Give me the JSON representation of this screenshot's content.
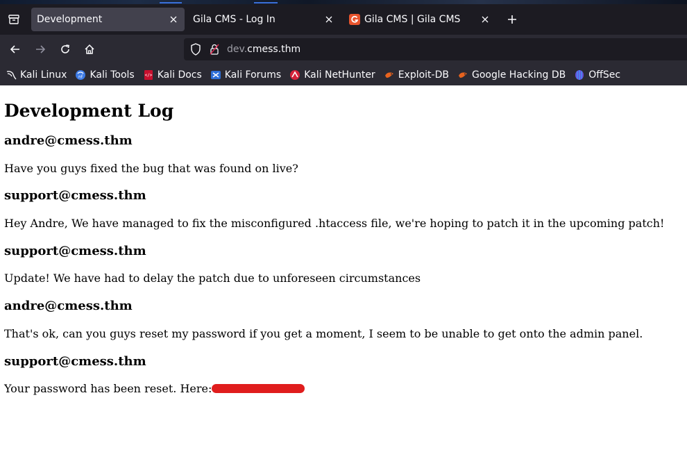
{
  "browser": {
    "tabs": [
      {
        "title": "Development",
        "active": true
      },
      {
        "title": "Gila CMS - Log In",
        "active": false
      },
      {
        "title": "Gila CMS | Gila CMS",
        "active": false,
        "favicon": "gila-favicon"
      }
    ],
    "url": {
      "subdomain": "dev.",
      "domain": "cmess.thm"
    },
    "bookmarks": [
      {
        "label": "Kali Linux",
        "icon": "kali-dragon-icon"
      },
      {
        "label": "Kali Tools",
        "icon": "kali-tools-icon"
      },
      {
        "label": "Kali Docs",
        "icon": "kali-docs-icon"
      },
      {
        "label": "Kali Forums",
        "icon": "kali-forums-icon"
      },
      {
        "label": "Kali NetHunter",
        "icon": "nethunter-icon"
      },
      {
        "label": "Exploit-DB",
        "icon": "exploit-db-icon"
      },
      {
        "label": "Google Hacking DB",
        "icon": "ghdb-icon"
      },
      {
        "label": "OffSec",
        "icon": "offsec-icon"
      }
    ],
    "colors": {
      "chrome_bg": "#1c1b22",
      "toolbar_bg": "#2b2a33",
      "active_tab": "#42414d"
    }
  },
  "page": {
    "title": "Development Log",
    "entries": [
      {
        "author": "andre@cmess.thm",
        "message": "Have you guys fixed the bug that was found on live?"
      },
      {
        "author": "support@cmess.thm",
        "message": "Hey Andre, We have managed to fix the misconfigured .htaccess file, we're hoping to patch it in the upcoming patch!"
      },
      {
        "author": "support@cmess.thm",
        "message": "Update! We have had to delay the patch due to unforeseen circumstances"
      },
      {
        "author": "andre@cmess.thm",
        "message": "That's ok, can you guys reset my password if you get a moment, I seem to be unable to get onto the admin panel."
      },
      {
        "author": "support@cmess.thm",
        "message": "Your password has been reset. Here:"
      }
    ],
    "redaction_color": "#e01d1d"
  }
}
